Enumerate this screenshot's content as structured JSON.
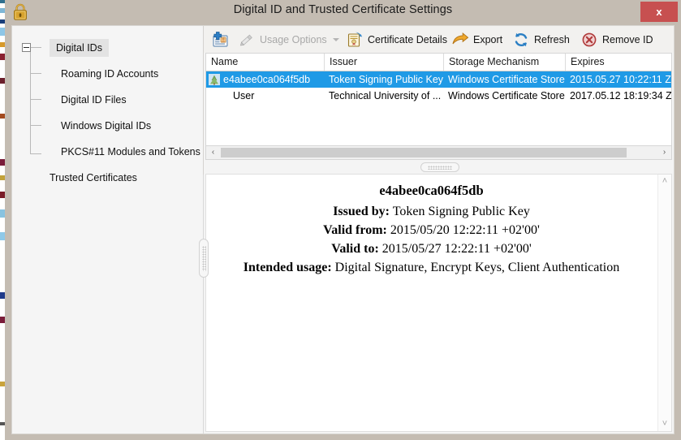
{
  "window": {
    "title": "Digital ID and Trusted Certificate Settings",
    "lock_icon": "padlock-icon",
    "close_label": "x",
    "close_color": "#c75050"
  },
  "sidebar": {
    "items": [
      {
        "label": "Digital IDs",
        "level": 0,
        "selected": true,
        "expander": "collapse-minus"
      },
      {
        "label": "Roaming ID Accounts",
        "level": 1,
        "selected": false
      },
      {
        "label": "Digital ID Files",
        "level": 1,
        "selected": false
      },
      {
        "label": "Windows Digital IDs",
        "level": 1,
        "selected": false
      },
      {
        "label": "PKCS#11 Modules and Tokens",
        "level": 1,
        "selected": false
      },
      {
        "label": "Trusted Certificates",
        "level": 0,
        "selected": false
      }
    ]
  },
  "toolbar": {
    "items": [
      {
        "label": "",
        "icon": "add-id-icon",
        "disabled": false,
        "caret": false
      },
      {
        "label": "Usage Options",
        "icon": "pencil-icon",
        "disabled": true,
        "caret": true
      },
      {
        "label": "Certificate Details",
        "icon": "certificate-details-icon",
        "disabled": false,
        "caret": false
      },
      {
        "label": "Export",
        "icon": "export-arrow-icon",
        "disabled": false,
        "caret": false
      },
      {
        "label": "Refresh",
        "icon": "refresh-icon",
        "disabled": false,
        "caret": false
      },
      {
        "label": "Remove ID",
        "icon": "remove-id-icon",
        "disabled": false,
        "caret": false
      }
    ]
  },
  "list": {
    "columns": [
      "Name",
      "Issuer",
      "Storage Mechanism",
      "Expires"
    ],
    "rows": [
      {
        "selected": true,
        "icon": "certificate-row-icon",
        "cells": [
          "e4abee0ca064f5db",
          "Token Signing Public Key",
          "Windows Certificate Store",
          "2015.05.27 10:22:11 Z"
        ]
      },
      {
        "selected": false,
        "icon": "",
        "cells": [
          "User",
          "Technical University of ...",
          "Windows Certificate Store",
          "2017.05.12 18:19:34 Z"
        ]
      }
    ],
    "selection_color": "#1f9ae6"
  },
  "scrollbars": {
    "h_left_arrow": "‹",
    "h_right_arrow": "›",
    "v_up_arrow": "˄",
    "v_down_arrow": "˅"
  },
  "detail": {
    "title": "e4abee0ca064f5db",
    "rows": [
      {
        "label": "Issued by:",
        "value": "Token Signing Public Key"
      },
      {
        "label": "Valid from:",
        "value": "2015/05/20 12:22:11 +02'00'"
      },
      {
        "label": "Valid to:",
        "value": "2015/05/27 12:22:11 +02'00'"
      },
      {
        "label": "Intended usage:",
        "value": "Digital Signature, Encrypt Keys, Client Authentication"
      }
    ]
  }
}
